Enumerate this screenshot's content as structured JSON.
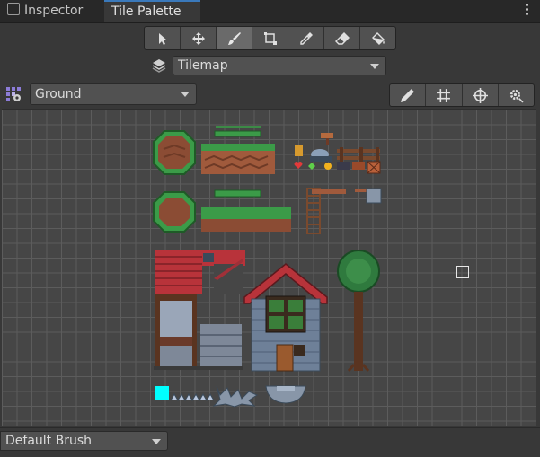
{
  "tabs": [
    {
      "label": "Inspector",
      "active": false
    },
    {
      "label": "Tile Palette",
      "active": true
    }
  ],
  "toolbar": {
    "tools": [
      "select-tool",
      "move-tool",
      "paint-brush-tool",
      "box-fill-tool",
      "pick-tool",
      "eraser-tool",
      "fill-tool"
    ],
    "selected_tool": "paint-brush-tool"
  },
  "target": {
    "selected": "Tilemap"
  },
  "palette": {
    "selected": "Ground"
  },
  "palette_buttons": [
    "edit-icon",
    "grid-icon",
    "gizmo-icon",
    "settings-icon"
  ],
  "brush": {
    "selected": "Default Brush"
  },
  "colors": {
    "accent": "#3a79bb",
    "panel": "#383838",
    "grid": "#464646",
    "highlight_tile": "#00ffff"
  }
}
